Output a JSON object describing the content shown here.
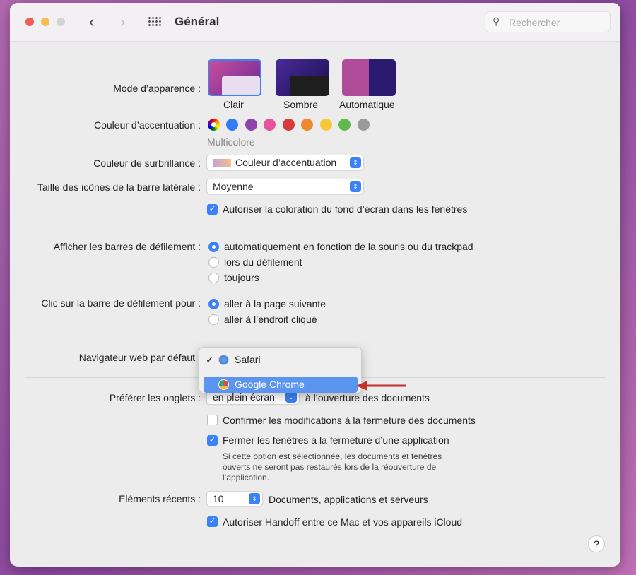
{
  "window": {
    "title": "Général",
    "search_placeholder": "Rechercher"
  },
  "appearance": {
    "label": "Mode d’apparence :",
    "options": [
      {
        "label": "Clair",
        "selected": true
      },
      {
        "label": "Sombre"
      },
      {
        "label": "Automatique"
      }
    ]
  },
  "accent": {
    "label": "Couleur d’accentuation :",
    "selected_label": "Multicolore",
    "colors": [
      "multicolor",
      "#2f7cf6",
      "#8e44ad",
      "#e8519c",
      "#d63a3a",
      "#ee8a2c",
      "#f6c736",
      "#5fb94c",
      "#9a9a9a"
    ]
  },
  "highlight": {
    "label": "Couleur de surbrillance :",
    "value": "Couleur d’accentuation"
  },
  "sidebar_icons": {
    "label": "Taille des icônes de la barre latérale :",
    "value": "Moyenne"
  },
  "wallpaper_tint": {
    "label": "Autoriser la coloration du fond d’écran dans les fenêtres",
    "checked": true
  },
  "scrollbars": {
    "label": "Afficher les barres de défilement :",
    "options": [
      {
        "label": "automatiquement en fonction de la souris ou du trackpad",
        "selected": true
      },
      {
        "label": "lors du défilement"
      },
      {
        "label": "toujours"
      }
    ]
  },
  "scroll_click": {
    "label": "Clic sur la barre de défilement pour :",
    "options": [
      {
        "label": "aller à la page suivante",
        "selected": true
      },
      {
        "label": "aller à l’endroit cliqué"
      }
    ]
  },
  "browser": {
    "label": "Navigateur web par défaut",
    "menu": [
      {
        "label": "Safari",
        "checked": true
      },
      {
        "label": "Google Chrome",
        "highlighted": true
      }
    ]
  },
  "tabs": {
    "label": "Préférer les onglets :",
    "value": "en plein écran",
    "suffix": "à l’ouverture des documents"
  },
  "confirm_changes": {
    "label": "Confirmer les modifications à la fermeture des documents",
    "checked": false
  },
  "close_windows": {
    "label": "Fermer les fenêtres à la fermeture d’une application",
    "checked": true,
    "help": [
      "Si cette option est sélectionnée, les documents et fenêtres",
      "ouverts ne seront pas restaurés lors de la réouverture de",
      "l’application."
    ]
  },
  "recent": {
    "label": "Éléments récents :",
    "value": "10",
    "suffix": "Documents, applications et serveurs"
  },
  "handoff": {
    "label": "Autoriser Handoff entre ce Mac et vos appareils iCloud",
    "checked": true
  },
  "help_button": "?",
  "colors": {
    "accent": "#3b82f6",
    "arrow": "#c0302c"
  }
}
